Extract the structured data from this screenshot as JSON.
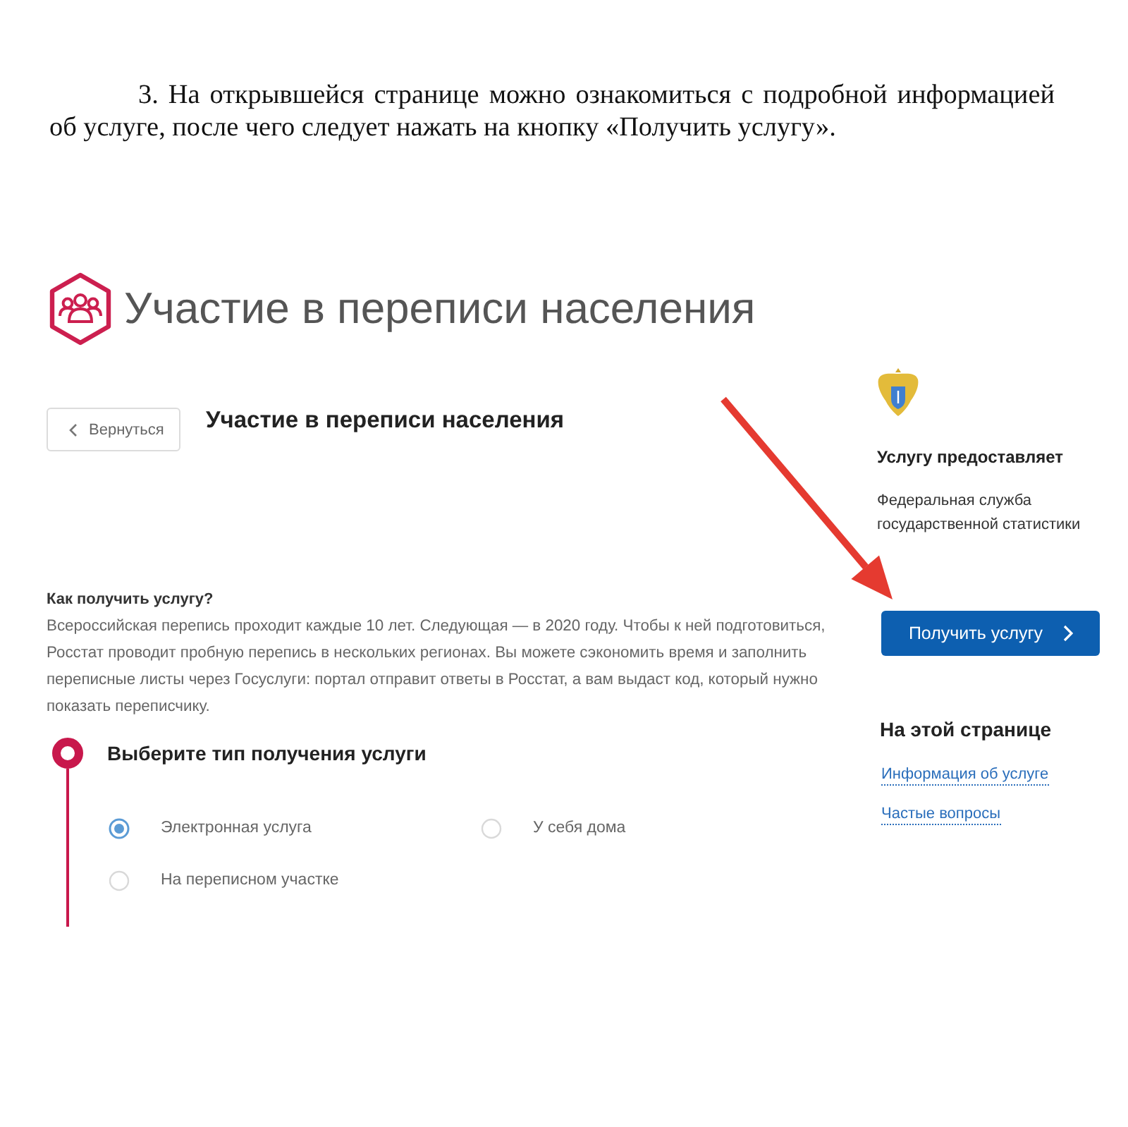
{
  "instruction": {
    "text": "3. На открывшейся странице можно ознакомиться с подробной информацией об услуге, после чего следует нажать на кнопку «Получить услугу»."
  },
  "screenshot": {
    "title": "Участие в переписи населения",
    "back_button": "Вернуться",
    "heading": "Участие в переписи населения",
    "provider": {
      "label": "Услугу предоставляет",
      "name": "Федеральная служба государственной статистики"
    },
    "primary_button": "Получить услугу",
    "on_this_page": {
      "title": "На этой странице",
      "links": [
        "Информация об услуге",
        "Частые вопросы"
      ]
    },
    "info": {
      "title": "Как получить услугу?",
      "text": "Всероссийская перепись проходит каждые 10 лет. Следующая — в 2020 году. Чтобы к ней подготовиться, Росстат проводит пробную перепись в нескольких регионах. Вы можете сэкономить время и заполнить переписные листы через Госуслуги: портал отправит ответы в Росстат, а вам выдаст код, который нужно показать переписчику."
    },
    "step": {
      "title": "Выберите тип получения услуги",
      "options": [
        {
          "label": "Электронная услуга",
          "selected": true
        },
        {
          "label": "У себя дома",
          "selected": false
        },
        {
          "label": "На переписном участке",
          "selected": false
        }
      ]
    }
  }
}
